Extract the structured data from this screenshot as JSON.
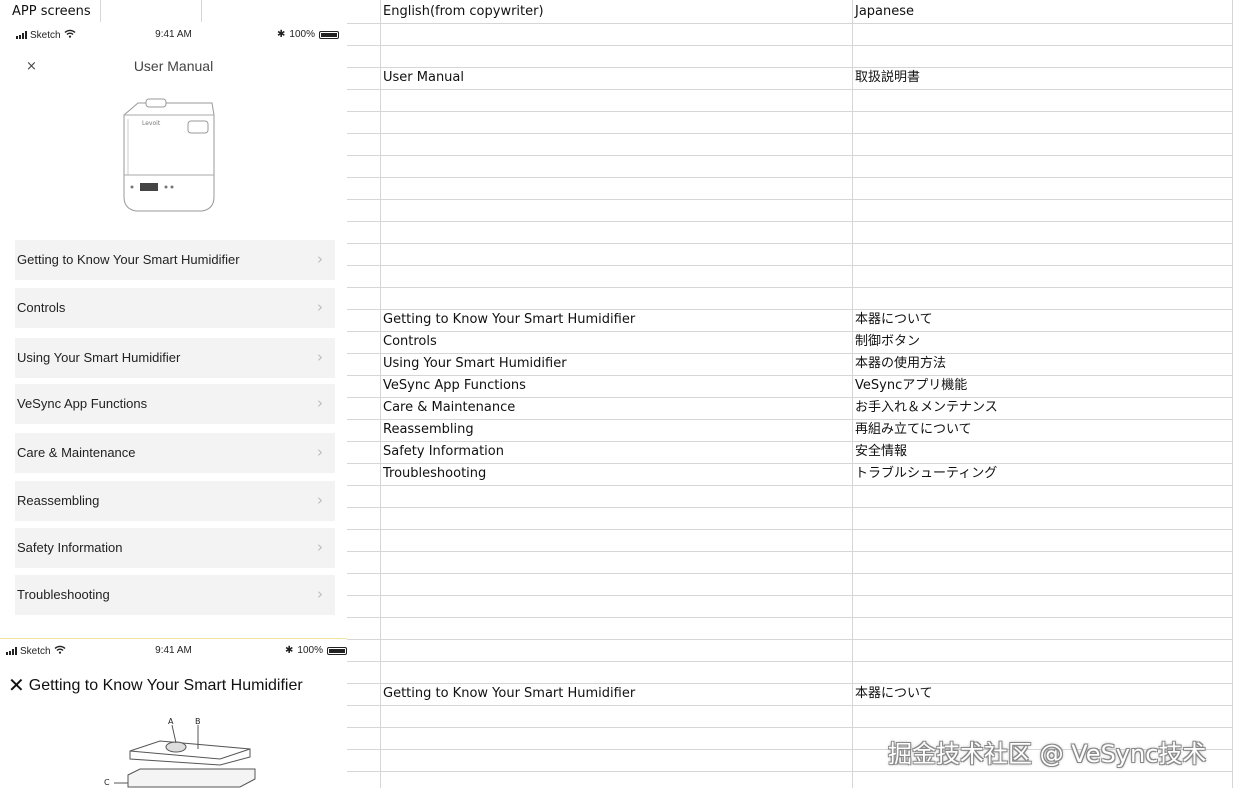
{
  "sheet": {
    "header_tab": "APP screens",
    "col_english": "English(from copywriter)",
    "col_japanese": "Japanese",
    "rows": [
      {
        "en": "User Manual",
        "ja": "取扱説明書"
      },
      {
        "en": "Getting to Know Your Smart Humidifier",
        "ja": "本器について"
      },
      {
        "en": "Controls",
        "ja": "制御ボタン"
      },
      {
        "en": "Using Your Smart Humidifier",
        "ja": "本器の使用方法"
      },
      {
        "en": "VeSync App Functions",
        "ja": "VeSyncアプリ機能"
      },
      {
        "en": "Care & Maintenance",
        "ja": "お手入れ＆メンテナンス"
      },
      {
        "en": "Reassembling",
        "ja": "再組み立てについて"
      },
      {
        "en": "Safety Information",
        "ja": "安全情報"
      },
      {
        "en": "Troubleshooting",
        "ja": "トラブルシューティング"
      },
      {
        "en": "Getting to Know Your Smart Humidifier",
        "ja": "本器について"
      }
    ]
  },
  "phone1": {
    "status": {
      "carrier": "Sketch",
      "time": "9:41 AM",
      "battery": "100%"
    },
    "close_label": "×",
    "title": "User Manual",
    "device_brand": "Levoit",
    "menu": [
      "Getting to Know Your Smart Humidifier",
      "Controls",
      "Using Your Smart Humidifier",
      "VeSync App Functions",
      "Care & Maintenance",
      "Reassembling",
      "Safety Information",
      "Troubleshooting"
    ],
    "chevron": "›"
  },
  "phone2": {
    "status": {
      "carrier": "Sketch",
      "time": "9:41 AM",
      "battery": "100%"
    },
    "title": "Getting to Know Your Smart Humidifier",
    "diagram_labels": [
      "A",
      "B",
      "C"
    ]
  },
  "watermark": "掘金技术社区 @ VeSync技术"
}
